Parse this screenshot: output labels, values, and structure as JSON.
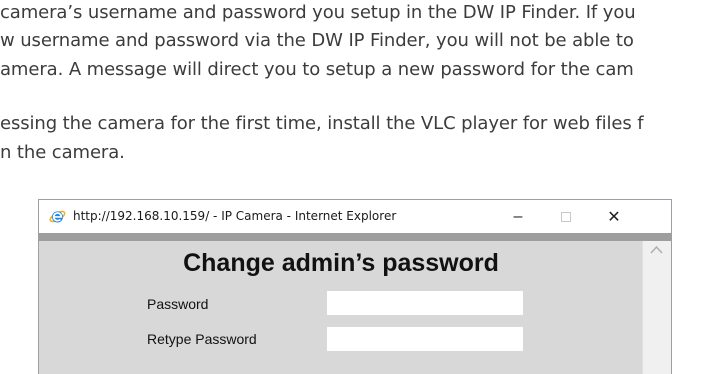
{
  "document": {
    "lines": [
      "camera’s username and password you setup in the DW IP Finder. If you",
      "w username and password via the DW IP Finder, you will not be able to",
      "amera. A message will direct you to setup a new password for the cam",
      "essing the camera for the first time, install the VLC player for web files f",
      "n the camera."
    ]
  },
  "browser": {
    "title": "http://192.168.10.159/ - IP Camera - Internet Explorer",
    "icon": "internet-explorer-icon",
    "minimize_glyph": "–",
    "close_glyph": "✕"
  },
  "form": {
    "heading": "Change admin’s password",
    "password_label": "Password",
    "retype_label": "Retype Password",
    "password_value": "",
    "retype_value": ""
  },
  "colors": {
    "content_bg": "#d8d8d8",
    "strip": "#9e9e9e",
    "ie_blue": "#1e88e5",
    "ie_gold": "#f2b01e"
  }
}
